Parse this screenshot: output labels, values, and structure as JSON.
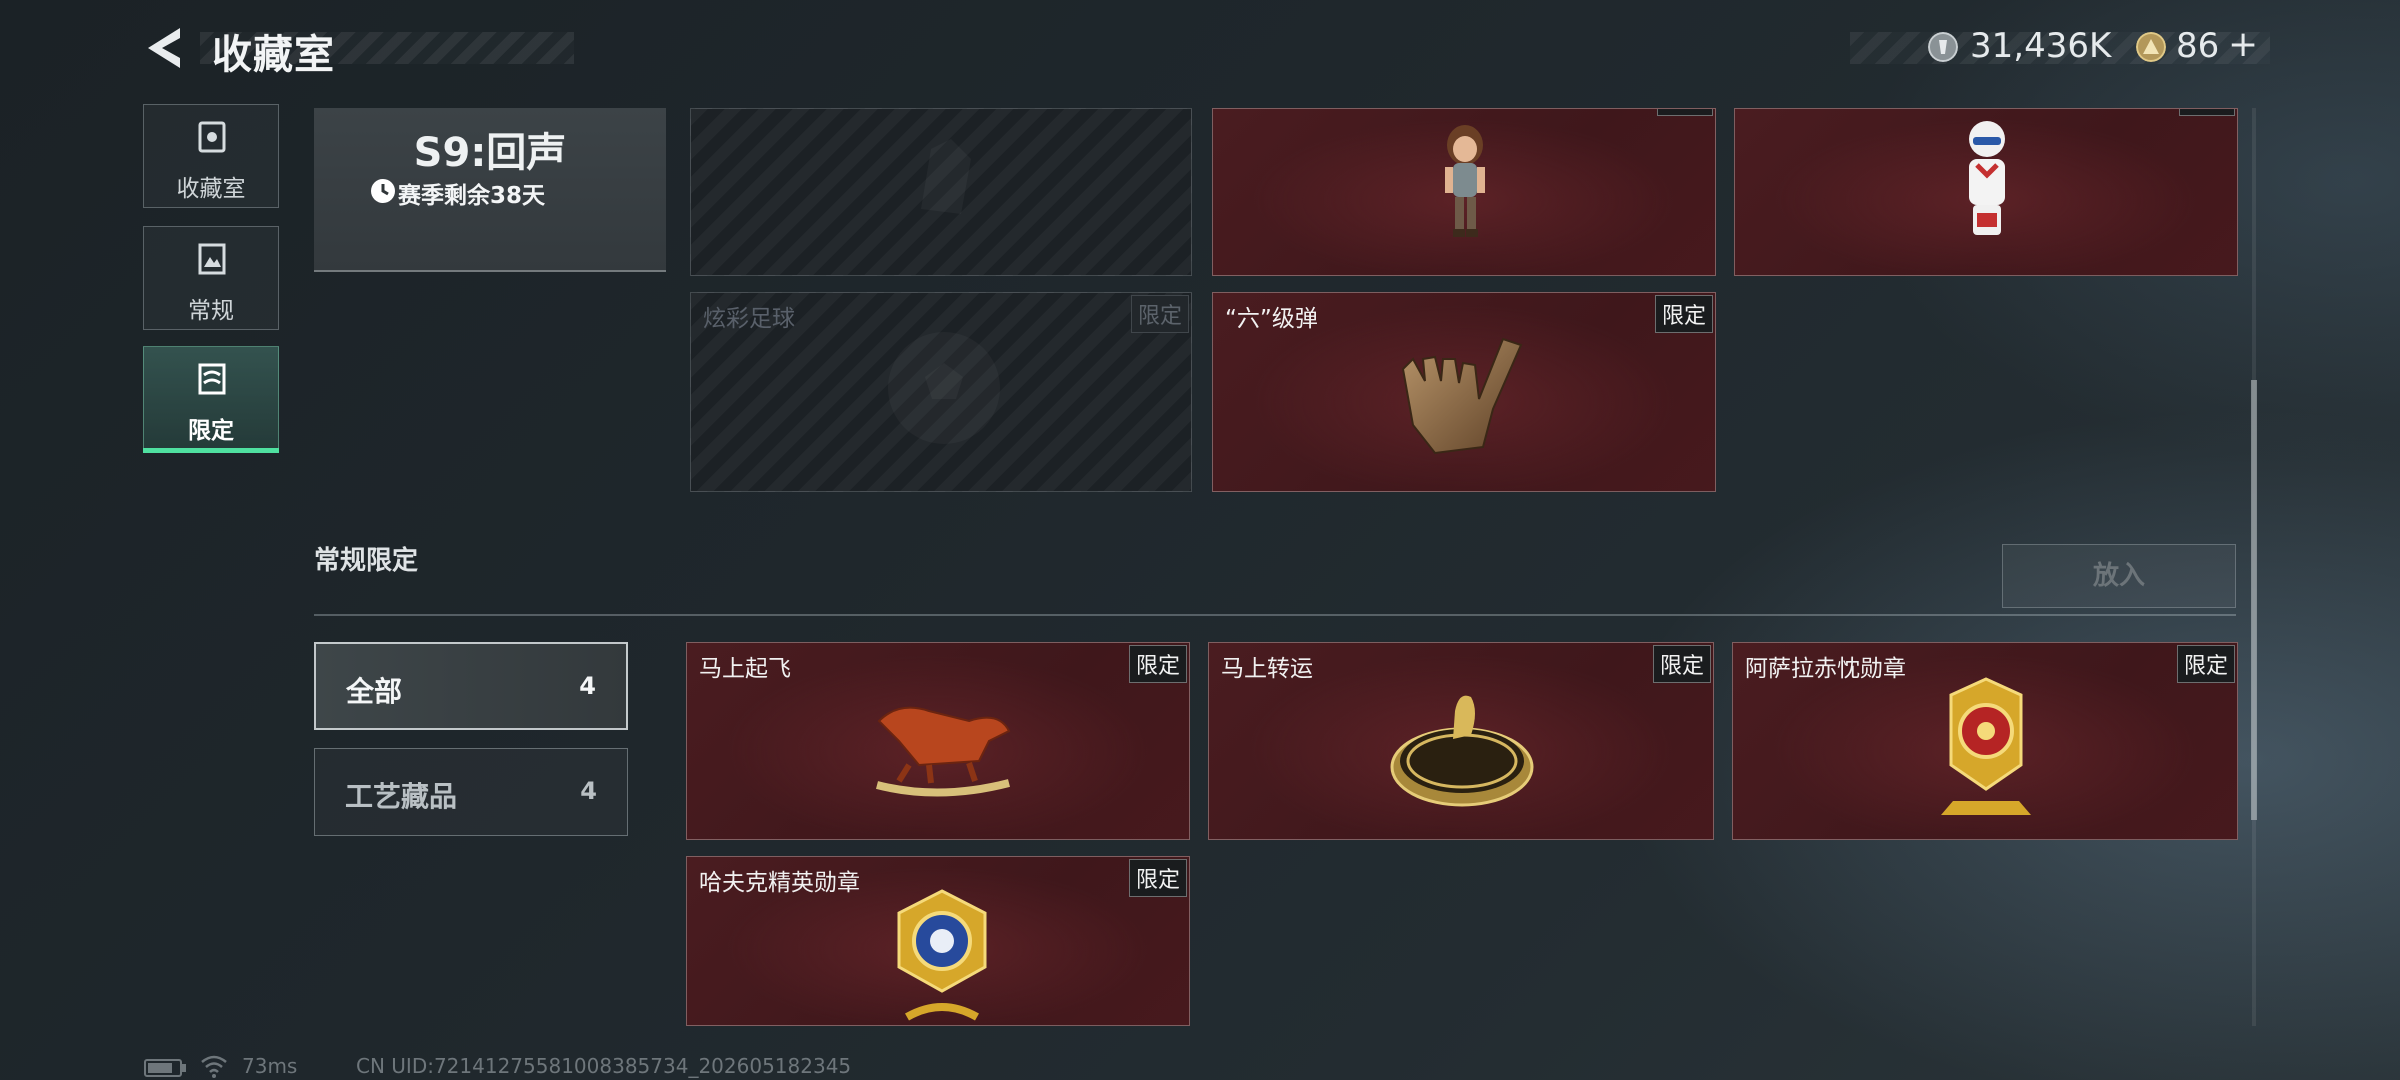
{
  "header": {
    "title": "收藏室",
    "currency_primary": "31,436K",
    "currency_secondary": "86",
    "add_symbol": "+"
  },
  "sidebar": {
    "items": [
      {
        "label": "收藏室",
        "icon": "vault-icon"
      },
      {
        "label": "常规",
        "icon": "document-icon"
      },
      {
        "label": "限定",
        "icon": "limited-icon",
        "active": true
      }
    ]
  },
  "season": {
    "name": "S9:回声",
    "remaining": "赛季剩余38天"
  },
  "season_items": [
    {
      "name": "",
      "badge": "",
      "state": "locked"
    },
    {
      "name": "",
      "badge": "",
      "state": "owned"
    },
    {
      "name": "",
      "badge": "",
      "state": "owned"
    },
    {
      "name": "炫彩足球",
      "badge": "限定",
      "state": "locked"
    },
    {
      "name": "“六”级弹",
      "badge": "限定",
      "state": "owned"
    }
  ],
  "regular_limited": {
    "title": "常规限定",
    "put_button": "放入",
    "filters": [
      {
        "label": "全部",
        "count": "4",
        "active": true
      },
      {
        "label": "工艺藏品",
        "count": "4",
        "active": false
      }
    ],
    "items": [
      {
        "name": "马上起飞",
        "badge": "限定"
      },
      {
        "name": "马上转运",
        "badge": "限定"
      },
      {
        "name": "阿萨拉赤忱勋章",
        "badge": "限定"
      },
      {
        "name": "哈夫克精英勋章",
        "badge": "限定"
      }
    ]
  },
  "footer": {
    "ping": "73ms",
    "uid": "CN UID:72141275581008385734_202605182345"
  },
  "colors": {
    "accent": "#4fe0a0",
    "card_red": "#47191d",
    "badge_bg": "#1a1c1e"
  }
}
